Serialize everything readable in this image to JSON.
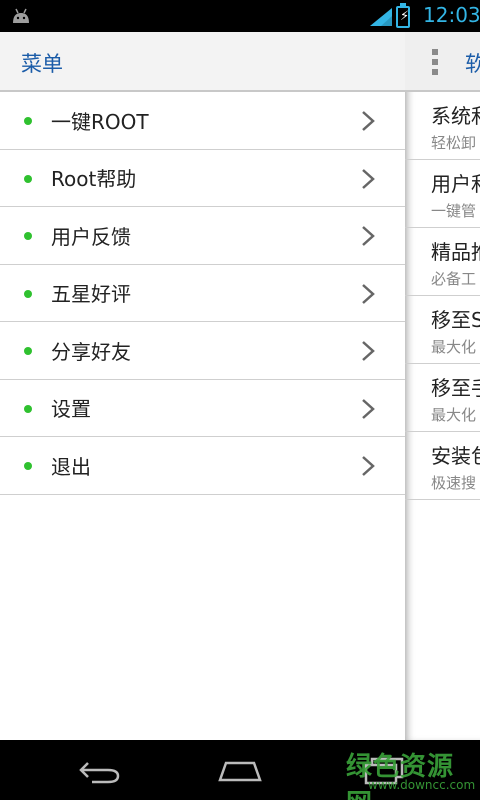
{
  "status_bar": {
    "time": "12:03",
    "battery_symbol": "⚡",
    "icons": [
      "android-debug-icon",
      "signal-icon",
      "battery-charging-icon"
    ]
  },
  "drawer": {
    "title": "菜单",
    "items": [
      {
        "label": "一键ROOT"
      },
      {
        "label": "Root帮助"
      },
      {
        "label": "用户反馈"
      },
      {
        "label": "五星好评"
      },
      {
        "label": "分享好友"
      },
      {
        "label": "设置"
      },
      {
        "label": "退出"
      }
    ]
  },
  "panel": {
    "title": "软",
    "items": [
      {
        "title": "系统和",
        "subtitle": "轻松卸"
      },
      {
        "title": "用户和",
        "subtitle": "一键管"
      },
      {
        "title": "精品推",
        "subtitle": "必备工"
      },
      {
        "title": "移至S",
        "subtitle": "最大化"
      },
      {
        "title": "移至手",
        "subtitle": "最大化"
      },
      {
        "title": "安装包",
        "subtitle": "极速搜"
      }
    ]
  },
  "watermark": {
    "text": "绿色资源网",
    "url": "www.downcc.com"
  },
  "colors": {
    "accent_blue": "#1b5ca8",
    "status_blue": "#33b5e5",
    "dot_green": "#2fc12f"
  }
}
